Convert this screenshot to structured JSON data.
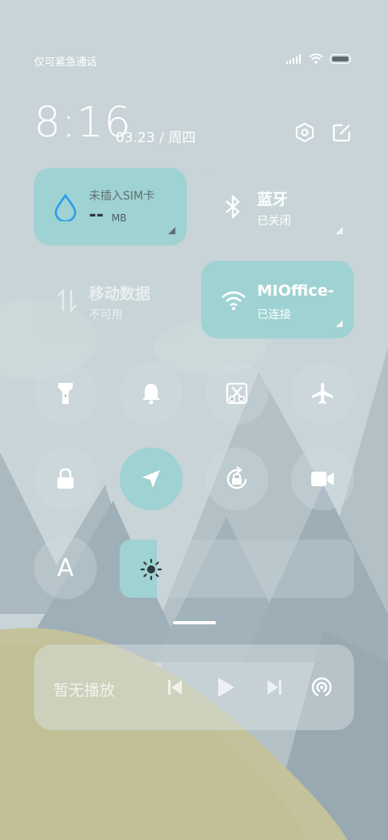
{
  "status": {
    "carrier_text": "仅可紧急通话",
    "icons": [
      "signal-icon",
      "wifi-icon",
      "battery-icon"
    ]
  },
  "header": {
    "time": "8:16",
    "date": "03.23 / 周四",
    "icons": [
      "settings-hex-icon",
      "edit-icon"
    ]
  },
  "tiles": {
    "data_usage": {
      "title": "未插入SIM卡",
      "value": "--",
      "unit": "MB",
      "icon": "water-drop-icon"
    },
    "bluetooth": {
      "title": "蓝牙",
      "status": "已关闭",
      "icon": "bluetooth-icon"
    },
    "mobile_data": {
      "title": "移动数据",
      "status": "不可用",
      "icon": "data-arrows-icon"
    },
    "wifi": {
      "title": "MIOffice-",
      "status": "已连接",
      "icon": "wifi-icon"
    }
  },
  "toggles": [
    {
      "name": "flashlight",
      "icon": "flashlight-icon",
      "active": false
    },
    {
      "name": "bell",
      "icon": "bell-icon",
      "active": false
    },
    {
      "name": "screenshot",
      "icon": "scissors-screenshot-icon",
      "active": false
    },
    {
      "name": "airplane",
      "icon": "airplane-icon",
      "active": false
    },
    {
      "name": "lock",
      "icon": "lock-icon",
      "active": false
    },
    {
      "name": "location",
      "icon": "location-arrow-icon",
      "active": true
    },
    {
      "name": "rotation-lock",
      "icon": "rotation-lock-icon",
      "active": false
    },
    {
      "name": "screen-record",
      "icon": "video-camera-icon",
      "active": false
    },
    {
      "name": "font",
      "icon": "font-a-icon",
      "active": false,
      "label": "A"
    }
  ],
  "brightness": {
    "level": 0.16,
    "icon": "sun-icon"
  },
  "media": {
    "title": "暂无播放",
    "icons": [
      "previous-icon",
      "play-icon",
      "next-icon",
      "cast-icon"
    ]
  },
  "colors": {
    "accent_teal": "#9fd2d2",
    "sky": "#c7d3d6",
    "mountain": "#a8b8c0",
    "hill": "#c4c29a",
    "drop_blue": "#2a9ee8"
  }
}
